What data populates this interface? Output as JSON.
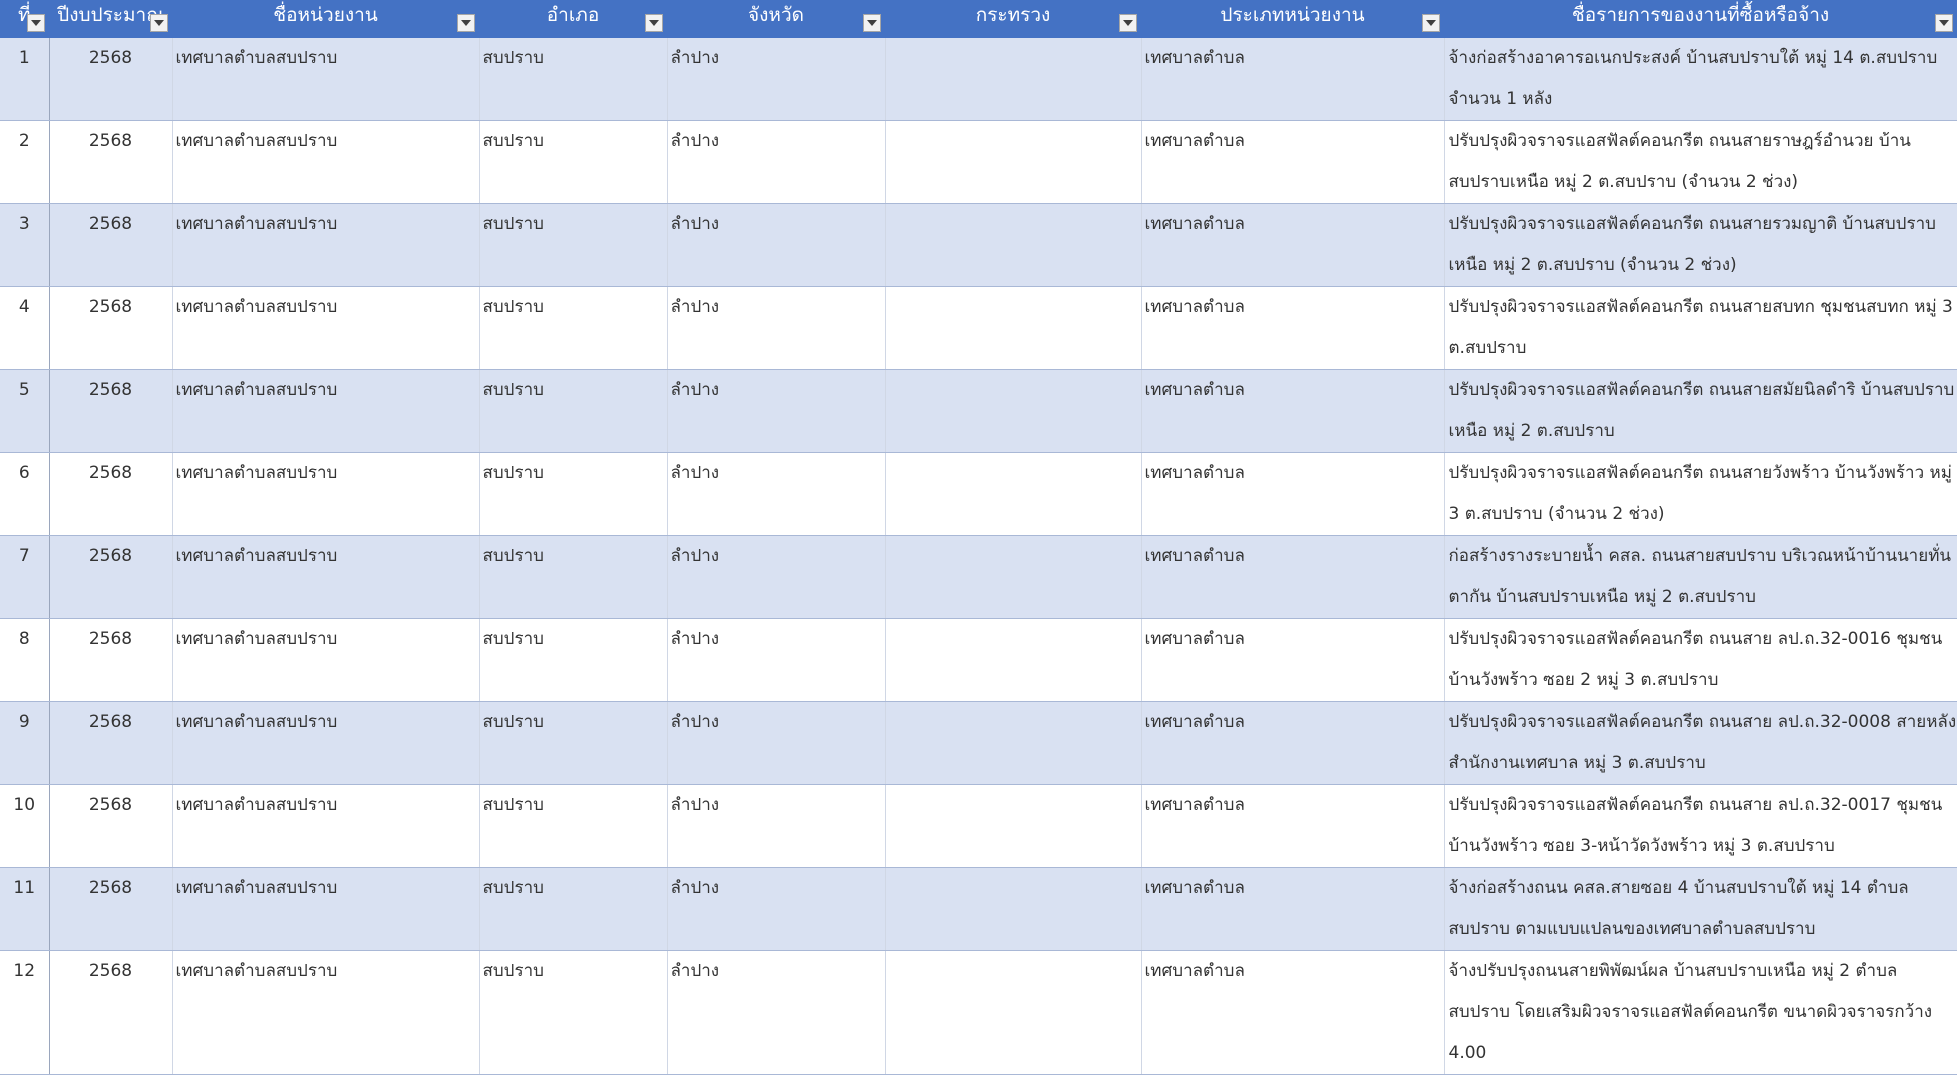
{
  "table": {
    "columns": [
      {
        "label": "ที่"
      },
      {
        "label": "ปีงบประมาณ"
      },
      {
        "label": "ชื่อหน่วยงาน"
      },
      {
        "label": "อำเภอ"
      },
      {
        "label": "จังหวัด"
      },
      {
        "label": "กระทรวง"
      },
      {
        "label": "ประเภทหน่วยงาน"
      },
      {
        "label": "ชื่อรายการของงานที่ซื้อหรือจ้าง"
      }
    ],
    "rows": [
      {
        "no": "1",
        "year": "2568",
        "agency": "เทศบาลตำบลสบปราบ",
        "district": "สบปราบ",
        "province": "ลำปาง",
        "ministry": "",
        "agency_type": "เทศบาลตำบล",
        "project": "จ้างก่อสร้างอาคารอเนกประสงค์ บ้านสบปราบใต้ หมู่ 14 ต.สบปราบ จำนวน 1 หลัง"
      },
      {
        "no": "2",
        "year": "2568",
        "agency": "เทศบาลตำบลสบปราบ",
        "district": "สบปราบ",
        "province": "ลำปาง",
        "ministry": "",
        "agency_type": "เทศบาลตำบล",
        "project": "ปรับปรุงผิวจราจรแอสฟัลต์คอนกรีต ถนนสายราษฎร์อำนวย บ้านสบปราบเหนือ หมู่ 2 ต.สบปราบ (จำนวน 2 ช่วง)"
      },
      {
        "no": "3",
        "year": "2568",
        "agency": "เทศบาลตำบลสบปราบ",
        "district": "สบปราบ",
        "province": "ลำปาง",
        "ministry": "",
        "agency_type": "เทศบาลตำบล",
        "project": "ปรับปรุงผิวจราจรแอสฟัลต์คอนกรีต ถนนสายรวมญาติ บ้านสบปราบเหนือ หมู่ 2 ต.สบปราบ (จำนวน 2 ช่วง)"
      },
      {
        "no": "4",
        "year": "2568",
        "agency": "เทศบาลตำบลสบปราบ",
        "district": "สบปราบ",
        "province": "ลำปาง",
        "ministry": "",
        "agency_type": "เทศบาลตำบล",
        "project": "ปรับปรุงผิวจราจรแอสฟัลต์คอนกรีต ถนนสายสบทก ชุมชนสบทก หมู่ 3 ต.สบปราบ"
      },
      {
        "no": "5",
        "year": "2568",
        "agency": "เทศบาลตำบลสบปราบ",
        "district": "สบปราบ",
        "province": "ลำปาง",
        "ministry": "",
        "agency_type": "เทศบาลตำบล",
        "project": "ปรับปรุงผิวจราจรแอสฟัลต์คอนกรีต ถนนสายสมัยนิลดำริ บ้านสบปราบเหนือ หมู่ 2 ต.สบปราบ"
      },
      {
        "no": "6",
        "year": "2568",
        "agency": "เทศบาลตำบลสบปราบ",
        "district": "สบปราบ",
        "province": "ลำปาง",
        "ministry": "",
        "agency_type": "เทศบาลตำบล",
        "project": "ปรับปรุงผิวจราจรแอสฟัลต์คอนกรีต ถนนสายวังพร้าว บ้านวังพร้าว หมู่ 3 ต.สบปราบ (จำนวน 2 ช่วง)"
      },
      {
        "no": "7",
        "year": "2568",
        "agency": "เทศบาลตำบลสบปราบ",
        "district": "สบปราบ",
        "province": "ลำปาง",
        "ministry": "",
        "agency_type": "เทศบาลตำบล",
        "project": "ก่อสร้างรางระบายน้ำ คสล. ถนนสายสบปราบ บริเวณหน้าบ้านนายทั่น ตากัน บ้านสบปราบเหนือ หมู่ 2 ต.สบปราบ"
      },
      {
        "no": "8",
        "year": "2568",
        "agency": "เทศบาลตำบลสบปราบ",
        "district": "สบปราบ",
        "province": "ลำปาง",
        "ministry": "",
        "agency_type": "เทศบาลตำบล",
        "project": "ปรับปรุงผิวจราจรแอสฟัลต์คอนกรีต ถนนสาย ลป.ถ.32-0016 ชุมชนบ้านวังพร้าว ซอย 2 หมู่ 3 ต.สบปราบ"
      },
      {
        "no": "9",
        "year": "2568",
        "agency": "เทศบาลตำบลสบปราบ",
        "district": "สบปราบ",
        "province": "ลำปาง",
        "ministry": "",
        "agency_type": "เทศบาลตำบล",
        "project": "ปรับปรุงผิวจราจรแอสฟัลต์คอนกรีต ถนนสาย ลป.ถ.32-0008 สายหลังสำนักงานเทศบาล หมู่ 3 ต.สบปราบ"
      },
      {
        "no": "10",
        "year": "2568",
        "agency": "เทศบาลตำบลสบปราบ",
        "district": "สบปราบ",
        "province": "ลำปาง",
        "ministry": "",
        "agency_type": "เทศบาลตำบล",
        "project": "ปรับปรุงผิวจราจรแอสฟัลต์คอนกรีต ถนนสาย ลป.ถ.32-0017 ชุมชนบ้านวังพร้าว ซอย 3-หน้าวัดวังพร้าว หมู่ 3 ต.สบปราบ"
      },
      {
        "no": "11",
        "year": "2568",
        "agency": "เทศบาลตำบลสบปราบ",
        "district": "สบปราบ",
        "province": "ลำปาง",
        "ministry": "",
        "agency_type": "เทศบาลตำบล",
        "project": "จ้างก่อสร้างถนน คสล.สายซอย 4 บ้านสบปราบใต้ หมู่ 14 ตำบลสบปราบ ตามแบบแปลนของเทศบาลตำบลสบปราบ"
      },
      {
        "no": "12",
        "year": "2568",
        "agency": "เทศบาลตำบลสบปราบ",
        "district": "สบปราบ",
        "province": "ลำปาง",
        "ministry": "",
        "agency_type": "เทศบาลตำบล",
        "project": "จ้างปรับปรุงถนนสายพิพัฒน์ผล บ้านสบปราบเหนือ หมู่ 2 ตำบลสบปราบ โดยเสริมผิวจราจรแอสฟัลต์คอนกรีต ขนาดผิวจราจรกว้าง 4.00"
      }
    ]
  },
  "colors": {
    "header_bg": "#4472c4",
    "band_bg": "#d9e1f2",
    "header_text": "#ffffff"
  },
  "icons": {
    "filter": "filter-dropdown-icon"
  }
}
